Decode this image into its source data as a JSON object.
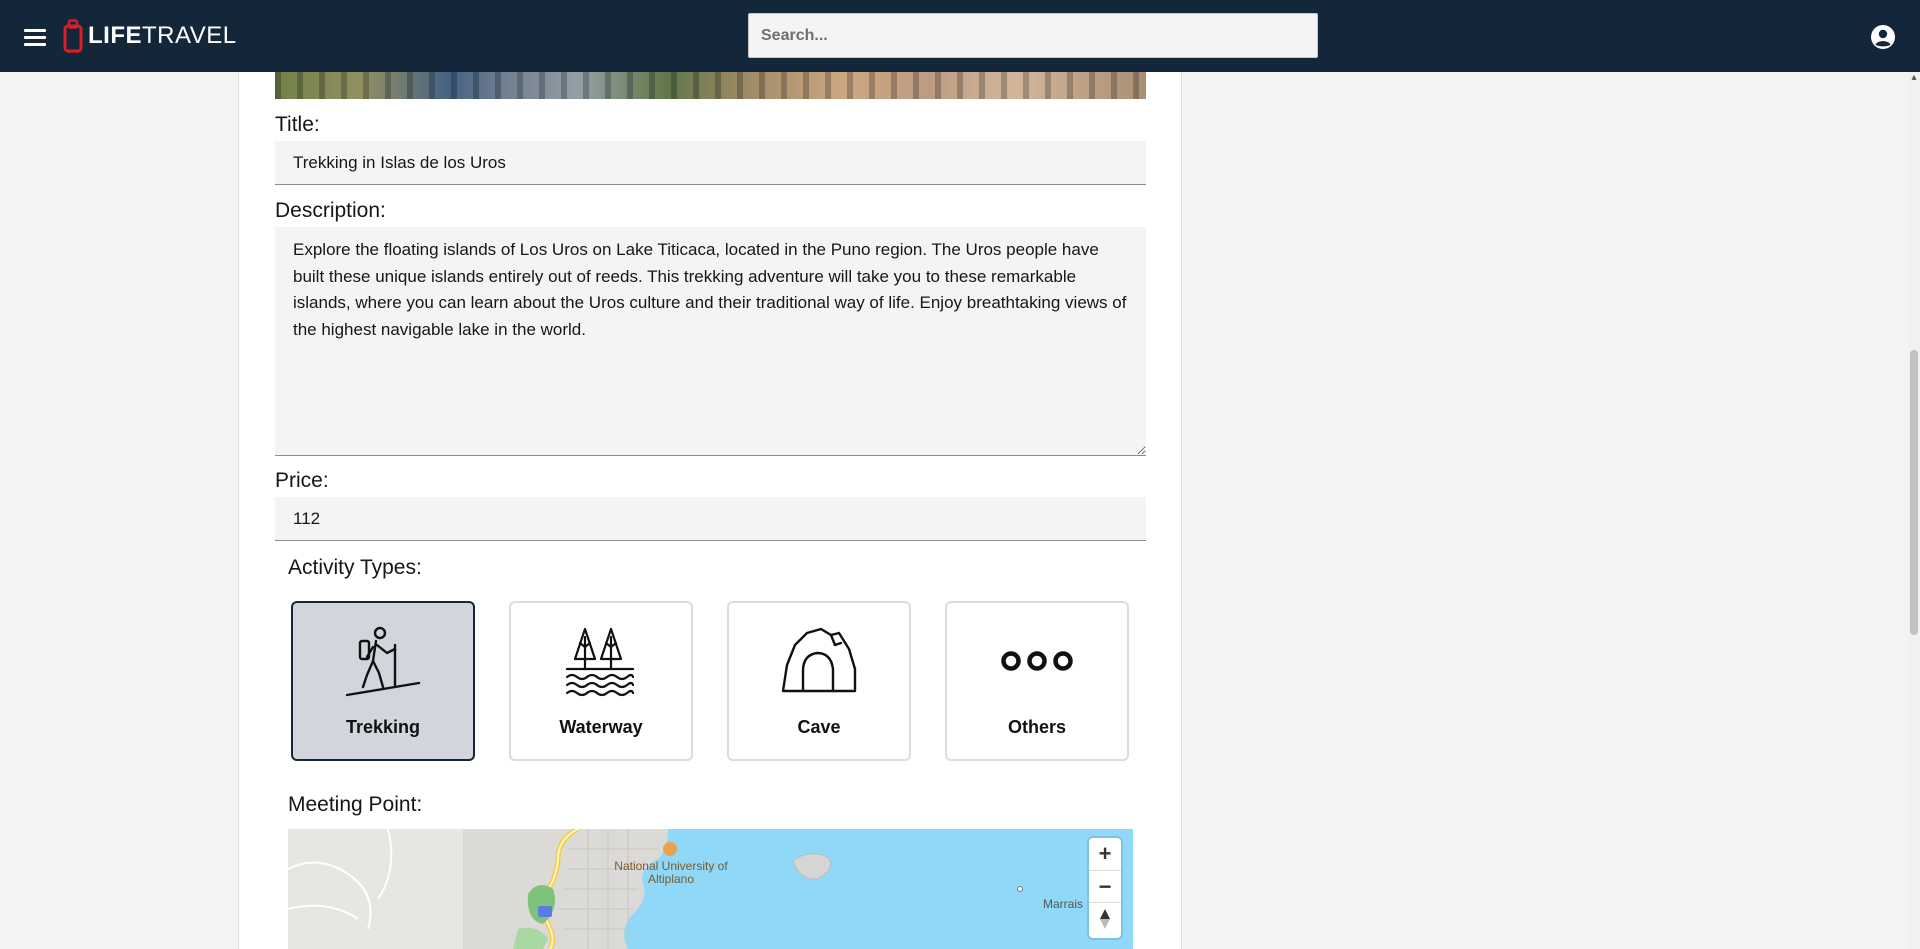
{
  "app": {
    "brand_strong": "LIFE",
    "brand_light": "TRAVEL",
    "search_placeholder": "Search..."
  },
  "form": {
    "title_label": "Title:",
    "title_value": "Trekking in Islas de los Uros",
    "description_label": "Description:",
    "description_value": "Explore the floating islands of Los Uros on Lake Titicaca, located in the Puno region. The Uros people have built these unique islands entirely out of reeds. This trekking adventure will take you to these remarkable islands, where you can learn about the Uros culture and their traditional way of life. Enjoy breathtaking views of the highest navigable lake in the world.",
    "price_label": "Price:",
    "price_value": "112",
    "activity_types_label": "Activity Types:",
    "activity_types": [
      {
        "label": "Trekking",
        "icon": "hiker-icon",
        "selected": true
      },
      {
        "label": "Waterway",
        "icon": "trees-water-icon",
        "selected": false
      },
      {
        "label": "Cave",
        "icon": "cave-icon",
        "selected": false
      },
      {
        "label": "Others",
        "icon": "three-circles-icon",
        "selected": false
      }
    ],
    "meeting_point_label": "Meeting Point:"
  },
  "map": {
    "university_label": "National University of Altiplano",
    "place_label": "Marrais",
    "zoom_in": "+",
    "zoom_out": "−",
    "water_color": "#8fd8f8",
    "land_color": "#e8e6e2"
  },
  "colors": {
    "header_bg": "#142639",
    "selected_card_bg": "#d2d6dc",
    "brand_red": "#da1e28"
  }
}
